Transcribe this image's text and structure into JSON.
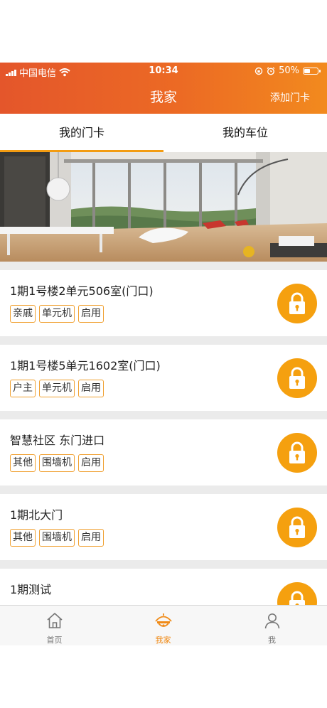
{
  "status_bar": {
    "carrier": "中国电信",
    "time": "10:34",
    "battery": "50%",
    "battery_level": 0.5
  },
  "nav": {
    "title": "我家",
    "action_label": "添加门卡"
  },
  "tabs": [
    {
      "label": "我的门卡",
      "active": true
    },
    {
      "label": "我的车位",
      "active": false
    }
  ],
  "cards": [
    {
      "title": "1期1号楼2单元506室(门口)",
      "tags": [
        "亲戚",
        "单元机",
        "启用"
      ]
    },
    {
      "title": "1期1号楼5单元1602室(门口)",
      "tags": [
        "户主",
        "单元机",
        "启用"
      ]
    },
    {
      "title": "智慧社区 东门进口",
      "tags": [
        "其他",
        "围墙机",
        "启用"
      ]
    },
    {
      "title": "1期北大门",
      "tags": [
        "其他",
        "围墙机",
        "启用"
      ]
    },
    {
      "title": "1期测试",
      "tags": []
    }
  ],
  "tabbar": [
    {
      "label": "首页",
      "icon": "home-icon",
      "active": false
    },
    {
      "label": "我家",
      "icon": "house-dome-icon",
      "active": true
    },
    {
      "label": "我",
      "icon": "user-icon",
      "active": false
    }
  ],
  "colors": {
    "header_start": "#e4562b",
    "header_end": "#f28a1e",
    "accent": "#f5a00f",
    "tab_active": "#f08a16",
    "tag_border": "#f0a030"
  }
}
